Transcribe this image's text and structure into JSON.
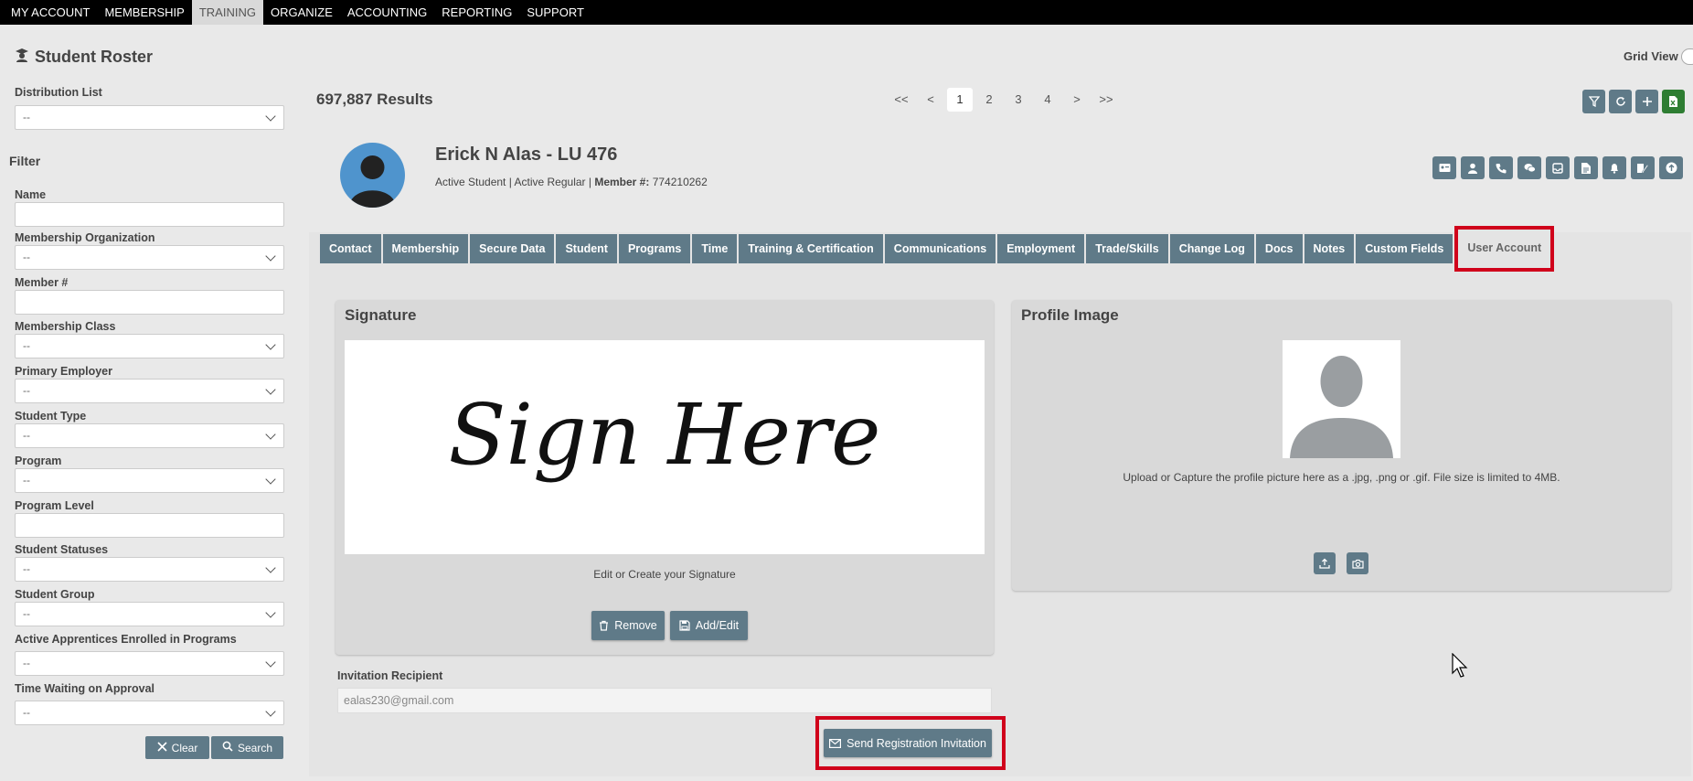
{
  "topnav": {
    "items": [
      "MY ACCOUNT",
      "MEMBERSHIP",
      "TRAINING",
      "ORGANIZE",
      "ACCOUNTING",
      "REPORTING",
      "SUPPORT"
    ],
    "active": "TRAINING"
  },
  "page": {
    "title": "Student Roster",
    "grid_view_label": "Grid View",
    "results": "697,887 Results"
  },
  "sidebar": {
    "distribution_list": {
      "label": "Distribution List",
      "value": "--"
    },
    "filter_heading": "Filter",
    "fields": [
      {
        "label": "Name",
        "value": ""
      },
      {
        "label": "Membership Organization",
        "value": "--"
      },
      {
        "label": "Member #",
        "value": ""
      },
      {
        "label": "Membership Class",
        "value": "--"
      },
      {
        "label": "Primary Employer",
        "value": "--"
      },
      {
        "label": "Student Type",
        "value": "--"
      },
      {
        "label": "Program",
        "value": "--"
      },
      {
        "label": "Program Level",
        "value": ""
      },
      {
        "label": "Student Statuses",
        "value": "--"
      },
      {
        "label": "Student Group",
        "value": "--"
      },
      {
        "label": "Active Apprentices Enrolled in Programs",
        "value": "--"
      },
      {
        "label": "Time Waiting on Approval",
        "value": "--"
      }
    ],
    "clear_label": "Clear",
    "search_label": "Search"
  },
  "pager": {
    "first": "<<",
    "prev": "<",
    "pages": [
      "1",
      "2",
      "3",
      "4"
    ],
    "next": ">",
    "last": ">>",
    "current": "1"
  },
  "member": {
    "name": "Erick N Alas - LU 476",
    "status": "Active Student | Active Regular | ",
    "member_no_label": "Member #:",
    "member_no": " 774210262"
  },
  "tabs": [
    "Contact",
    "Membership",
    "Secure Data",
    "Student",
    "Programs",
    "Time",
    "Training & Certification",
    "Communications",
    "Employment",
    "Trade/Skills",
    "Change Log",
    "Docs",
    "Notes",
    "Custom Fields",
    "User Account"
  ],
  "active_tab": "User Account",
  "signature": {
    "title": "Signature",
    "placeholder_text": "Sign Here",
    "caption": "Edit or Create your Signature",
    "remove_label": "Remove",
    "add_edit_label": "Add/Edit"
  },
  "profile": {
    "title": "Profile Image",
    "caption": "Upload or Capture the profile picture here as a .jpg, .png or .gif. File size is limited to 4MB."
  },
  "invitation": {
    "label": "Invitation Recipient",
    "value": "ealas230@gmail.com",
    "send_label": "Send Registration Invitation"
  },
  "colors": {
    "button": "#5f7a88",
    "green_button": "#2e7d32",
    "highlight": "#d0021b",
    "avatar_bg": "#4f94cd"
  }
}
